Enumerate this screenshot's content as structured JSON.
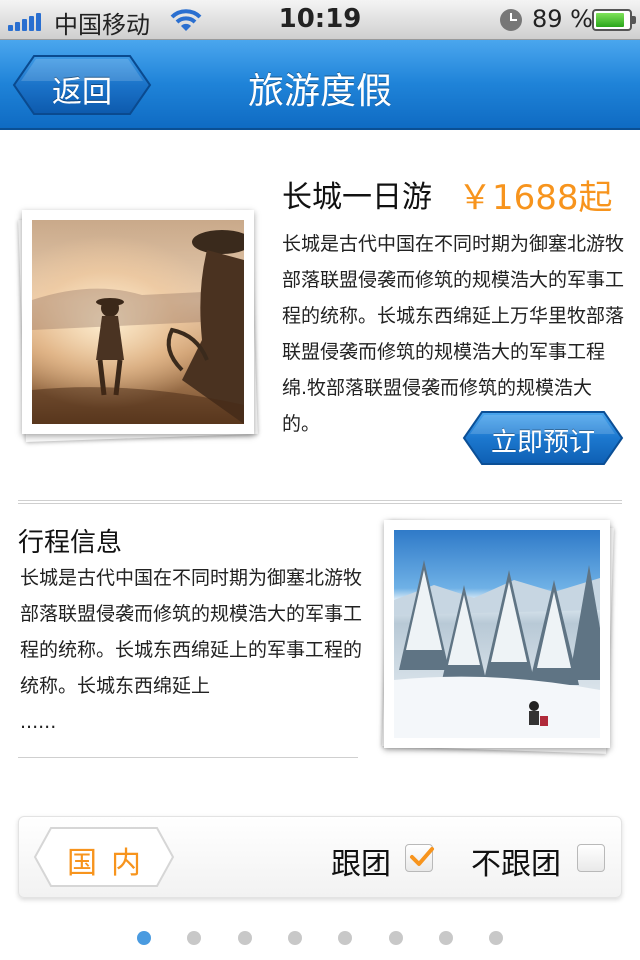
{
  "status_bar": {
    "carrier": "中国移动",
    "time": "10:19",
    "battery_percent": "89 %",
    "battery_level": 0.89
  },
  "nav": {
    "back_label": "返回",
    "title": "旅游度假"
  },
  "product": {
    "title": "长城一日游",
    "price": "￥1688起",
    "description": "长城是古代中国在不同时期为御塞北游牧部落联盟侵袭而修筑的规模浩大的军事工程的统称。长城东西绵延上万华里牧部落联盟侵袭而修筑的规模浩大的军事工程绵.牧部落联盟侵袭而修筑的规模浩大的。",
    "book_label": "立即预订"
  },
  "itinerary": {
    "title": "行程信息",
    "description": "长城是古代中国在不同时期为御塞北游牧部落联盟侵袭而修筑的规模浩大的军事工程的统称。长城东西绵延上的军事工程的统称。长城东西绵延上",
    "more": "......"
  },
  "filter": {
    "region_label": "国内",
    "with_group_label": "跟团",
    "with_group_checked": true,
    "no_group_label": "不跟团",
    "no_group_checked": false
  },
  "pagination": {
    "total": 8,
    "active_index": 0
  },
  "colors": {
    "accent_orange": "#f7941d",
    "nav_blue": "#1f83d8",
    "dot_active": "#4a9be0",
    "dot_inactive": "#c8c8c8"
  }
}
